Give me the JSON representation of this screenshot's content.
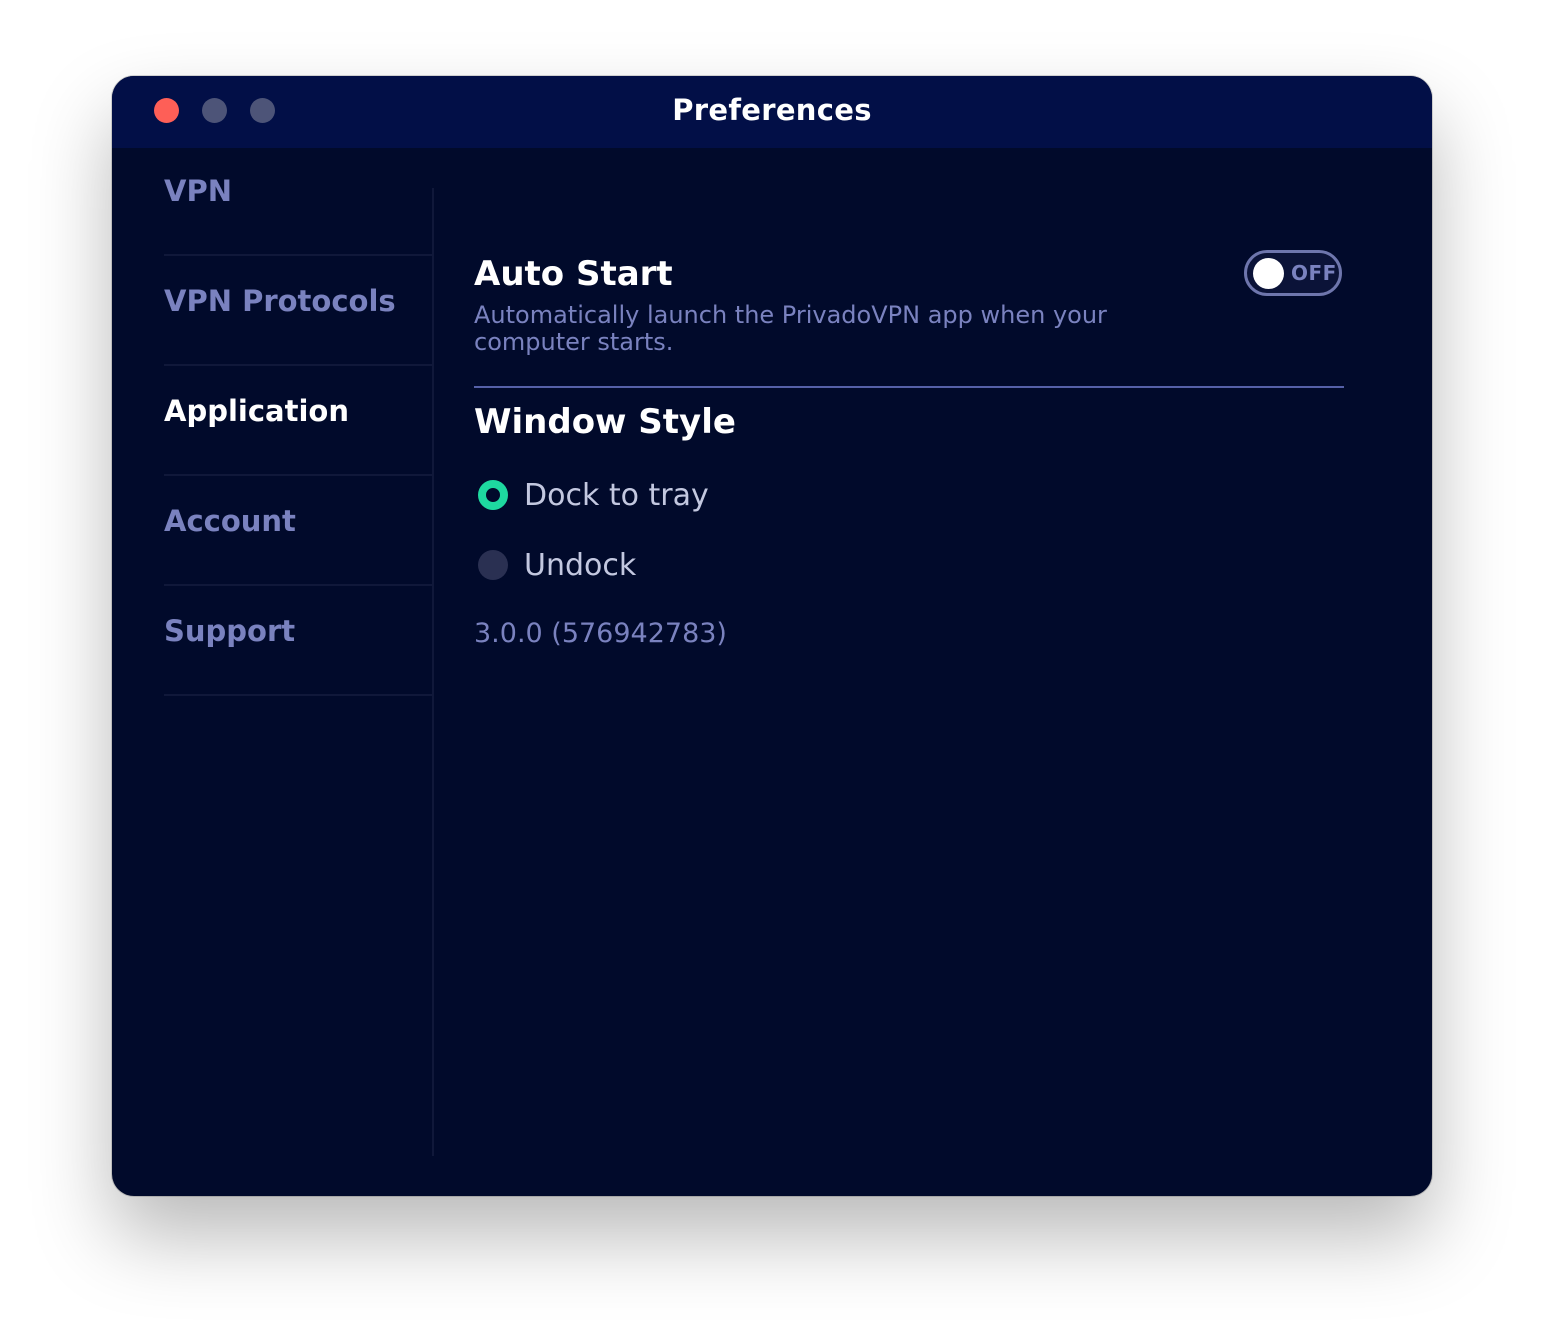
{
  "window": {
    "title": "Preferences"
  },
  "sidebar": {
    "items": [
      {
        "label": "VPN",
        "active": false
      },
      {
        "label": "VPN Protocols",
        "active": false
      },
      {
        "label": "Application",
        "active": true
      },
      {
        "label": "Account",
        "active": false
      },
      {
        "label": "Support",
        "active": false
      }
    ]
  },
  "auto_start": {
    "title": "Auto Start",
    "description": "Automatically launch the PrivadoVPN app when your computer starts.",
    "toggle_state": "OFF",
    "enabled": false
  },
  "window_style": {
    "title": "Window Style",
    "options": [
      {
        "label": "Dock to tray",
        "selected": true
      },
      {
        "label": "Undock",
        "selected": false
      }
    ]
  },
  "version": "3.0.0 (576942783)",
  "colors": {
    "window_bg": "#010a2b",
    "titlebar_bg": "#020f47",
    "accent_green": "#1ed9a0",
    "muted_text": "#7a82bf",
    "close_button": "#fe5f57"
  }
}
